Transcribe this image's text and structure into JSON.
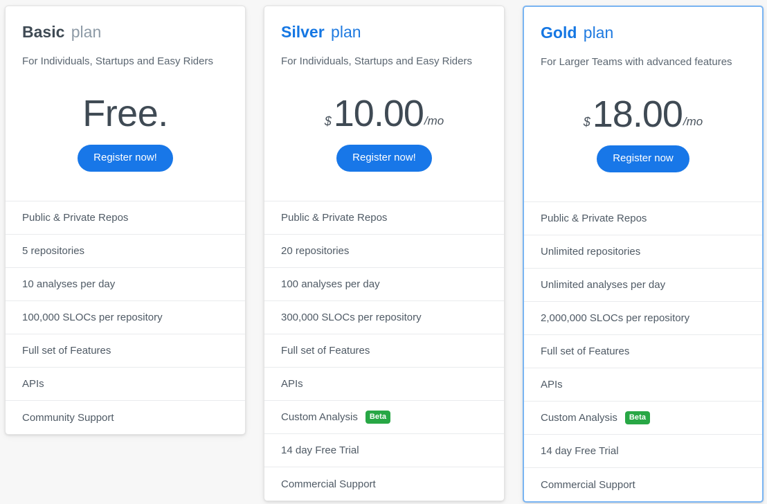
{
  "page": {
    "background_color": "#f7f7f7",
    "accent_color": "#1877e8",
    "badge_color": "#28a745",
    "highlight_border_color": "#79b4f2"
  },
  "plans": [
    {
      "tier": "Basic",
      "plan_word": "plan",
      "tagline": "For Individuals, Startups and Easy Riders",
      "price_free_label": "Free.",
      "currency": "",
      "amount": "",
      "period": "",
      "cta_label": "Register now!",
      "features": [
        {
          "label": "Public & Private Repos",
          "badge": ""
        },
        {
          "label": "5 repositories",
          "badge": ""
        },
        {
          "label": "10 analyses per day",
          "badge": ""
        },
        {
          "label": "100,000 SLOCs per repository",
          "badge": ""
        },
        {
          "label": "Full set of Features",
          "badge": ""
        },
        {
          "label": "APIs",
          "badge": ""
        },
        {
          "label": "Community Support",
          "badge": ""
        }
      ]
    },
    {
      "tier": "Silver",
      "plan_word": "plan",
      "tagline": "For Individuals, Startups and Easy Riders",
      "price_free_label": "",
      "currency": "$",
      "amount": "10.00",
      "period": "/mo",
      "cta_label": "Register now!",
      "features": [
        {
          "label": "Public & Private Repos",
          "badge": ""
        },
        {
          "label": "20 repositories",
          "badge": ""
        },
        {
          "label": "100 analyses per day",
          "badge": ""
        },
        {
          "label": "300,000 SLOCs per repository",
          "badge": ""
        },
        {
          "label": "Full set of Features",
          "badge": ""
        },
        {
          "label": "APIs",
          "badge": ""
        },
        {
          "label": "Custom Analysis",
          "badge": "Beta"
        },
        {
          "label": "14 day Free Trial",
          "badge": ""
        },
        {
          "label": "Commercial Support",
          "badge": ""
        }
      ]
    },
    {
      "tier": "Gold",
      "plan_word": "plan",
      "tagline": "For Larger Teams with advanced features",
      "price_free_label": "",
      "currency": "$",
      "amount": "18.00",
      "period": "/mo",
      "cta_label": "Register now",
      "features": [
        {
          "label": "Public & Private Repos",
          "badge": ""
        },
        {
          "label": "Unlimited repositories",
          "badge": ""
        },
        {
          "label": "Unlimited analyses per day",
          "badge": ""
        },
        {
          "label": "2,000,000 SLOCs per repository",
          "badge": ""
        },
        {
          "label": "Full set of Features",
          "badge": ""
        },
        {
          "label": "APIs",
          "badge": ""
        },
        {
          "label": "Custom Analysis",
          "badge": "Beta"
        },
        {
          "label": "14 day Free Trial",
          "badge": ""
        },
        {
          "label": "Commercial Support",
          "badge": ""
        }
      ]
    }
  ]
}
